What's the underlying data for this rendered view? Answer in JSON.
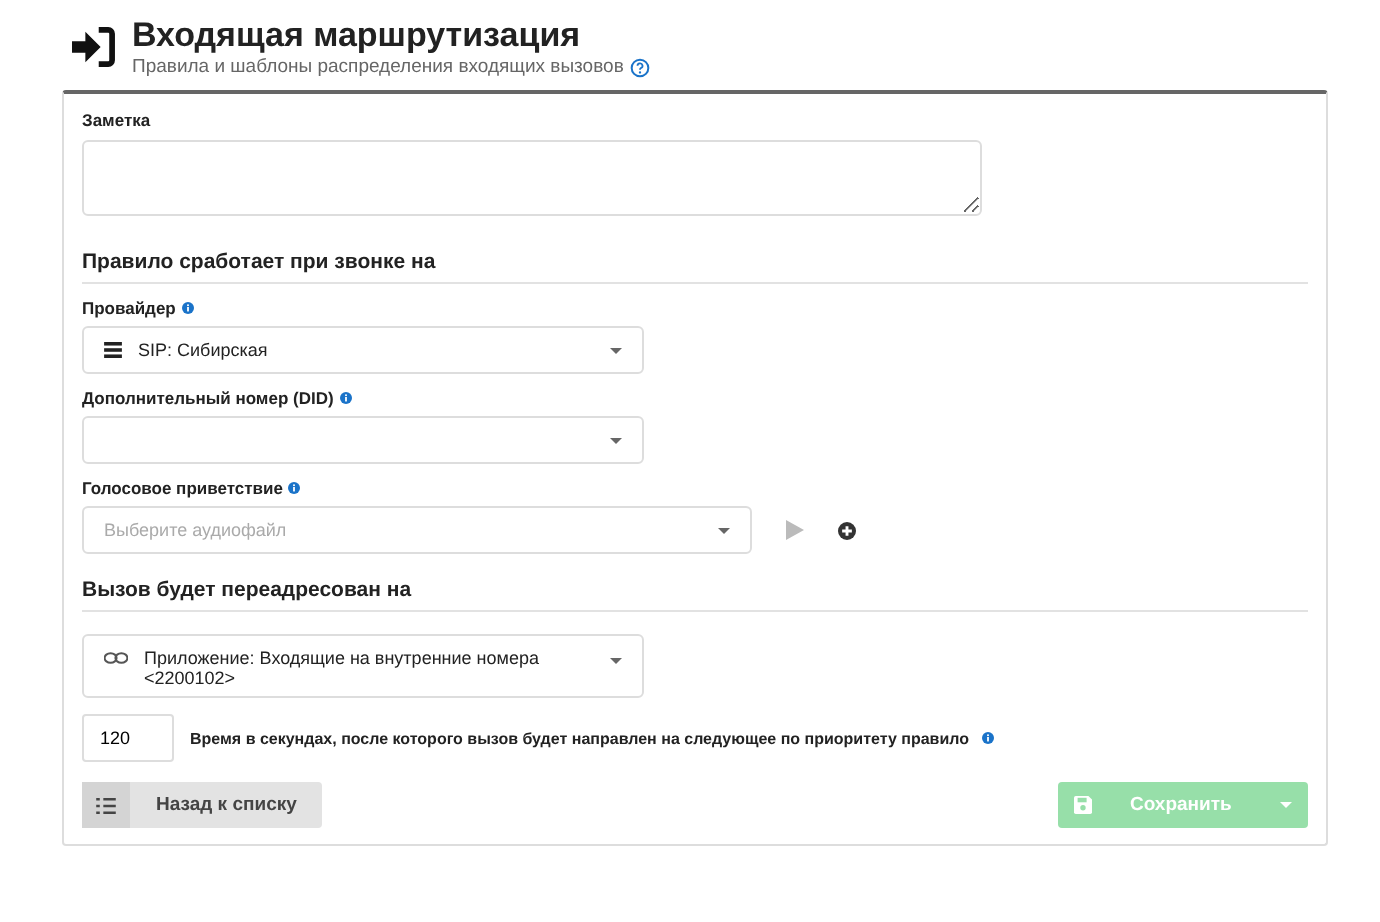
{
  "header": {
    "title": "Входящая маршрутизация",
    "subtitle": "Правила и шаблоны распределения входящих вызовов"
  },
  "note": {
    "label": "Заметка"
  },
  "section_trigger": {
    "title": "Правило сработает при звонке на",
    "fields": [
      {
        "label": "Провайдер",
        "kind": "select",
        "value": "SIP: Сибирская"
      },
      {
        "label": "Дополнительный номер (DID)",
        "kind": "select"
      },
      {
        "label": "Голосовое приветствие",
        "kind": "audio",
        "placeholder": "Выберите аудиофайл"
      }
    ]
  },
  "section_forward": {
    "title": "Вызов будет переадресован на",
    "target": {
      "value": "Приложение: Входящие на внутренние номера <2200102>"
    },
    "timeout": {
      "value": "120",
      "label": "Время в секундах, после которого вызов будет направлен на следующее по приоритету правило"
    }
  },
  "buttons": {
    "back": {
      "label": "Назад к списку"
    },
    "save": {
      "label": "Сохранить",
      "disabled": true
    }
  }
}
